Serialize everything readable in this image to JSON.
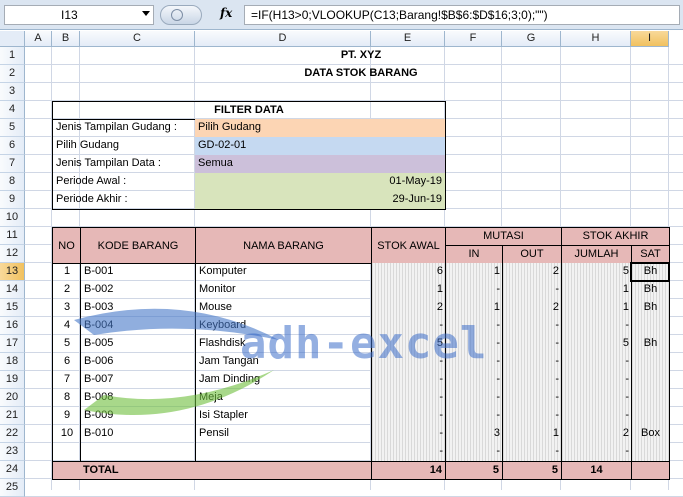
{
  "formula_bar": {
    "name_box": "I13",
    "fx_label": "fx",
    "formula": "=IF(H13>0;VLOOKUP(C13;Barang!$B$6:$D$16;3;0);\"\")"
  },
  "columns": [
    "A",
    "B",
    "C",
    "D",
    "E",
    "F",
    "G",
    "H",
    "I"
  ],
  "selected_column": "I",
  "rows": [
    "1",
    "2",
    "3",
    "4",
    "5",
    "6",
    "7",
    "8",
    "9",
    "10",
    "11",
    "12",
    "13",
    "14",
    "15",
    "16",
    "17",
    "18",
    "19",
    "20",
    "21",
    "22",
    "23",
    "24",
    "25"
  ],
  "selected_row": "13",
  "title": {
    "company": "PT. XYZ",
    "report": "DATA STOK BARANG"
  },
  "filter": {
    "header": "FILTER DATA",
    "rows": [
      {
        "label": "Jenis Tampilan Gudang :",
        "value": "Pilih Gudang"
      },
      {
        "label": "Pilih Gudang",
        "value": "GD-02-01"
      },
      {
        "label": "Jenis Tampilan Data :",
        "value": "Semua"
      },
      {
        "label": "Periode Awal :",
        "value": "01-May-19"
      },
      {
        "label": "Periode Akhir :",
        "value": "29-Jun-19"
      }
    ]
  },
  "table": {
    "headers": {
      "no": "NO",
      "kode": "KODE BARANG",
      "nama": "NAMA BARANG",
      "stok_awal": "STOK AWAL",
      "mutasi": "MUTASI",
      "in": "IN",
      "out": "OUT",
      "stok_akhir": "STOK AKHIR",
      "jumlah": "JUMLAH",
      "sat": "SAT"
    },
    "rows": [
      {
        "no": "1",
        "kode": "B-001",
        "nama": "Komputer",
        "awal": "6",
        "in": "1",
        "out": "2",
        "jumlah": "5",
        "sat": "Bh"
      },
      {
        "no": "2",
        "kode": "B-002",
        "nama": "Monitor",
        "awal": "1",
        "in": "-",
        "out": "-",
        "jumlah": "1",
        "sat": "Bh"
      },
      {
        "no": "3",
        "kode": "B-003",
        "nama": "Mouse",
        "awal": "2",
        "in": "1",
        "out": "2",
        "jumlah": "1",
        "sat": "Bh"
      },
      {
        "no": "4",
        "kode": "B-004",
        "nama": "Keyboard",
        "awal": "-",
        "in": "-",
        "out": "-",
        "jumlah": "-",
        "sat": ""
      },
      {
        "no": "5",
        "kode": "B-005",
        "nama": "Flashdisk",
        "awal": "5",
        "in": "-",
        "out": "-",
        "jumlah": "5",
        "sat": "Bh"
      },
      {
        "no": "6",
        "kode": "B-006",
        "nama": "Jam Tangan",
        "awal": "-",
        "in": "-",
        "out": "-",
        "jumlah": "-",
        "sat": ""
      },
      {
        "no": "7",
        "kode": "B-007",
        "nama": "Jam Dinding",
        "awal": "-",
        "in": "-",
        "out": "-",
        "jumlah": "-",
        "sat": ""
      },
      {
        "no": "8",
        "kode": "B-008",
        "nama": "Meja",
        "awal": "-",
        "in": "-",
        "out": "-",
        "jumlah": "-",
        "sat": ""
      },
      {
        "no": "9",
        "kode": "B-009",
        "nama": "Isi Stapler",
        "awal": "-",
        "in": "-",
        "out": "-",
        "jumlah": "-",
        "sat": ""
      },
      {
        "no": "10",
        "kode": "B-010",
        "nama": "Pensil",
        "awal": "-",
        "in": "3",
        "out": "1",
        "jumlah": "2",
        "sat": "Box"
      },
      {
        "no": "",
        "kode": "",
        "nama": "",
        "awal": "-",
        "in": "-",
        "out": "-",
        "jumlah": "-",
        "sat": ""
      }
    ],
    "total": {
      "label": "TOTAL",
      "awal": "14",
      "in": "5",
      "out": "5",
      "jumlah": "14"
    }
  },
  "watermark": "adh-excel",
  "colors": {
    "header_pink": "#e6b8b7",
    "orange": "#fcd5b4",
    "blue": "#c5d9f1",
    "purple": "#ccc0da",
    "green": "#d8e4bc"
  }
}
